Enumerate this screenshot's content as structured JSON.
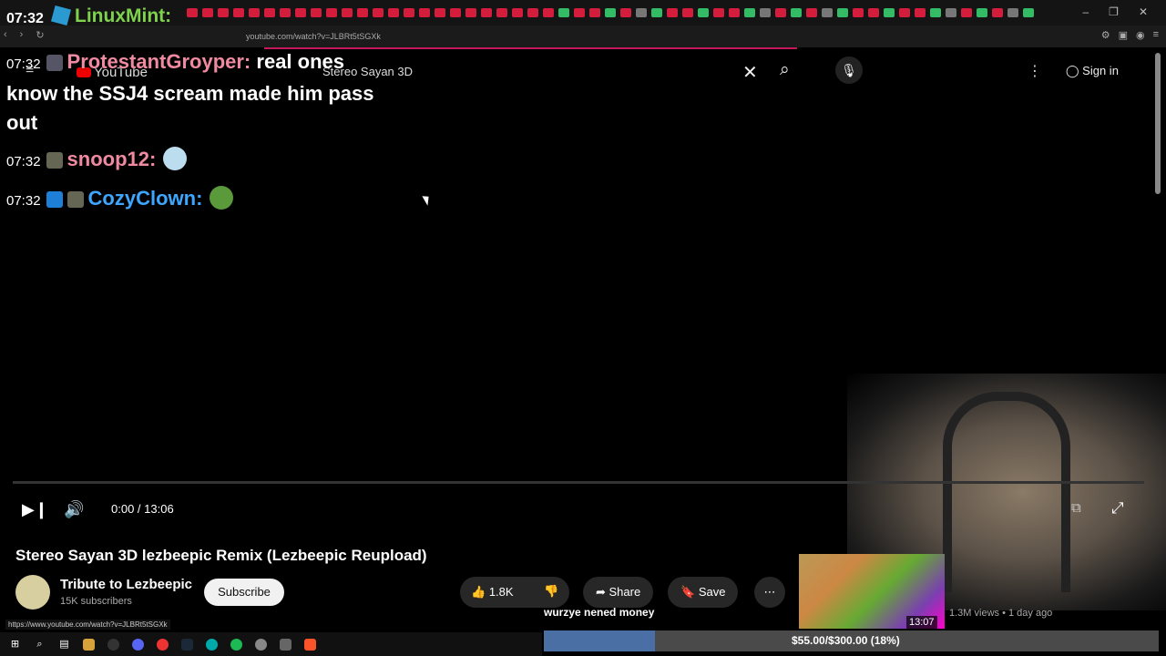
{
  "overlay": {
    "clock": "07:32",
    "brand": "LinuxMint:"
  },
  "browser": {
    "url": "youtube.com/watch?v=JLBRt5tSGXk",
    "status_url": "https://www.youtube.com/watch?v=JLBRt5tSGXk"
  },
  "youtube": {
    "logo": "YouTube",
    "search_query": "Stereo Sayan 3D",
    "sign_in": "Sign in"
  },
  "chat": [
    {
      "time": "07:32",
      "user": "ProtestantGroyper:",
      "text": "real ones know the SSJ4 scream made him pass out",
      "color": "#f08aa0"
    },
    {
      "time": "07:32",
      "user": "snoop12:",
      "text": "",
      "color": "#f08aa0"
    },
    {
      "time": "07:32",
      "user": "CozyClown:",
      "text": "",
      "color": "#3ea6ff"
    }
  ],
  "player": {
    "time": "0:00 / 13:06",
    "progress": 0
  },
  "video": {
    "title": "Stereo Sayan 3D lezbeepic Remix (Lezbeepic Reupload)",
    "channel": "Tribute to Lezbeepic",
    "subscribers": "15K subscribers",
    "subscribe_label": "Subscribe",
    "likes": "1.8K",
    "share_label": "Share",
    "save_label": "Save",
    "views": "1.3M views • 1 day ago",
    "thumb_duration": "13:07"
  },
  "donation": {
    "message": "wurzye nened money",
    "label": "$55.00/$300.00 (18%)",
    "fraction": 0.18,
    "color": "#4a6fa5"
  }
}
